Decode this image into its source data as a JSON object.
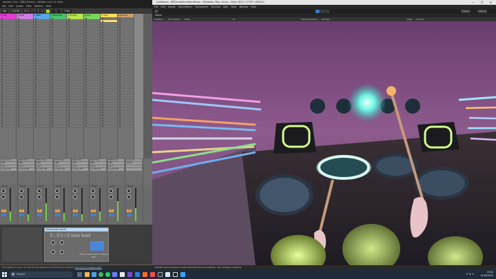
{
  "ableton": {
    "title": "Ableton Live - [BBA Demo] - Ableton Live 11 Suite",
    "menu": [
      "File",
      "Edit",
      "Create",
      "View",
      "Options",
      "Help"
    ],
    "transport": {
      "tap": "Tap",
      "tempo": "120.00",
      "signature": "4 / 4",
      "position": "1 . 1 . 1",
      "quantize": "1 Bar"
    },
    "tracks": [
      {
        "name": "1 Inst",
        "color": "#e23fd4"
      },
      {
        "name": "2 MIDI",
        "color": "#cf7fe2"
      },
      {
        "name": "3 MIDI",
        "color": "#5aa7e8"
      },
      {
        "name": "4 BassInstr",
        "color": "#49c36b"
      },
      {
        "name": "5 Drums",
        "color": "#b8e24f"
      },
      {
        "name": "6 Kick",
        "color": "#7bd55a"
      },
      {
        "name": "7 Instr",
        "color": "#ffdb5b"
      },
      {
        "name": "A Reverb",
        "color": "#c9a26b"
      }
    ],
    "io_rows": [
      {
        "label": "Audio From",
        "src": "BBA",
        "ch": "Ch. 1",
        "mon": "In Auto Off"
      },
      {
        "label": "MIDI From",
        "src": "BBA",
        "ch": "Ch. 2",
        "mon": "In Auto Off"
      },
      {
        "label": "MIDI From",
        "src": "BBA",
        "ch": "Ch. 3",
        "mon": "In Auto Off"
      },
      {
        "label": "MIDI From",
        "src": "BBA",
        "ch": "Ch. 4",
        "mon": "In Auto Off"
      },
      {
        "label": "MIDI From",
        "src": "BBA",
        "ch": "Ch. 5",
        "mon": "In Auto Off"
      },
      {
        "label": "MIDI From",
        "src": "BBA",
        "ch": "Ch. 6",
        "mon": "In Auto Off"
      },
      {
        "label": "MIDI From",
        "src": "BBA",
        "ch": "Ch. 7",
        "mon": "In Auto Off"
      },
      {
        "label": "Audio To",
        "src": "Master",
        "ch": "",
        "mon": ""
      }
    ],
    "mixer": {
      "sends": "Sends",
      "track_levels": [
        0.3,
        0.2,
        0.55,
        0.25,
        0.2,
        0.3,
        0.6,
        0.4
      ]
    },
    "device": {
      "title": "PitchedInstruments",
      "btn1": "Trigger Mode",
      "btn2": "Rhythm Mode",
      "btn3": "Advanced",
      "btn4": "Sample",
      "note": "Drop an Instrument or Sample Here"
    },
    "status": "The update to version 11.3.20 will be applied the next time Live is started.",
    "status_link": "Click here for release notes."
  },
  "unity": {
    "title": "LiveDemo - BBCombi/Architectethon - Windows, Mac, Linux - Unity 2022.3.17f1* <DX11>",
    "menu": [
      "File",
      "Edit",
      "Assets",
      "GameObject",
      "Component",
      "Services",
      "Jobs",
      "Tools",
      "Window",
      "Help"
    ],
    "layers": "Layers",
    "layout": "Layout",
    "scene_tab": "Game",
    "game_bar": {
      "display": "Display 1",
      "aspect": "Free Aspect",
      "scale": "Scale",
      "scale_value": "1x",
      "play_mode": "Play Maximized",
      "eye": "Left Eye",
      "stats": "Stats",
      "gizmos": "Gizmos"
    },
    "status": "BoBnBa (GroundAspects Instrument) PitchInstrumentNode: Idle (waiting 0 instants)"
  },
  "taskbar": {
    "search": "Search",
    "lang": "ENG",
    "region": "US",
    "time": "15:42",
    "date": "01/05/2024"
  }
}
